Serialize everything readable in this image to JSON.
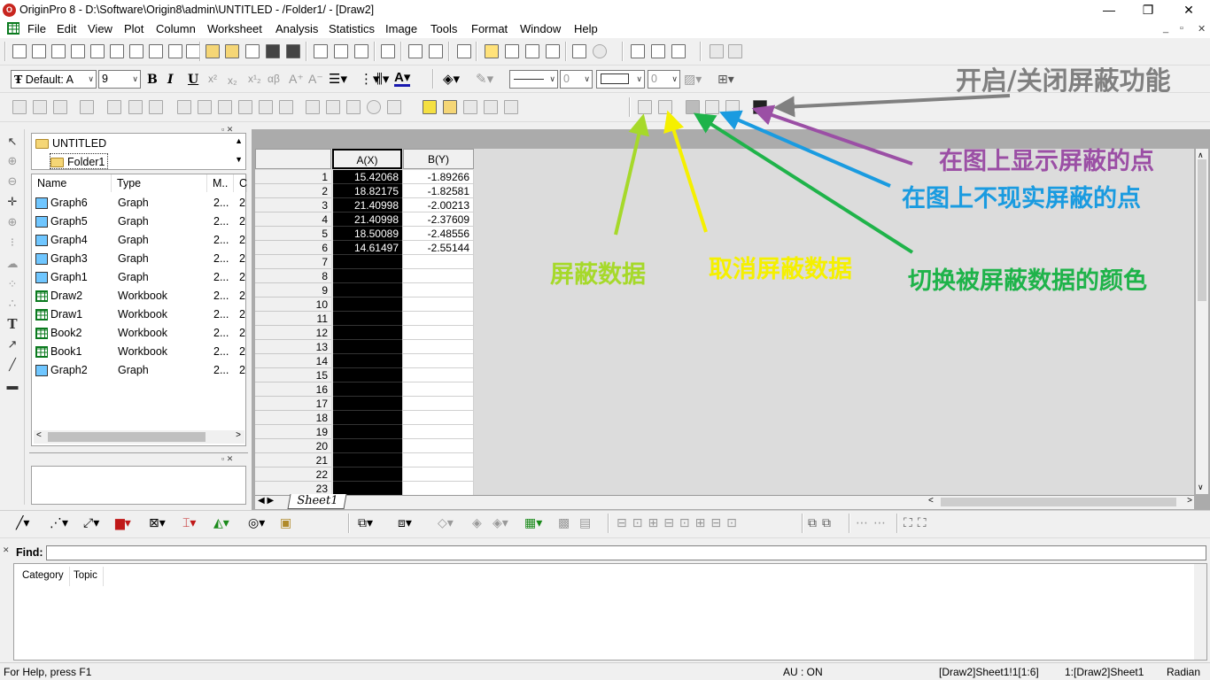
{
  "title_bar": {
    "title": "OriginPro 8 - D:\\Software\\Origin8\\admin\\UNTITLED - /Folder1/ - [Draw2]",
    "minimize": "—",
    "restore": "❐",
    "close": "✕"
  },
  "menu": {
    "items": [
      "File",
      "Edit",
      "View",
      "Plot",
      "Column",
      "Worksheet",
      "Analysis",
      "Statistics",
      "Image",
      "Tools",
      "Format",
      "Window",
      "Help"
    ],
    "mdi_minimize": "_",
    "mdi_restore": "▫",
    "mdi_close": "✕"
  },
  "format_toolbar": {
    "font": "Default: A",
    "size": "9",
    "bold": "B",
    "italic": "I",
    "underline": "U",
    "line_width": "0",
    "pattern_width": "0"
  },
  "project_explorer": {
    "root": "UNTITLED",
    "folder": "Folder1",
    "columns": [
      "Name",
      "Type",
      "M..",
      "C"
    ],
    "items": [
      {
        "name": "Graph6",
        "type": "Graph",
        "m": "2...",
        "c": "2",
        "kind": "graph"
      },
      {
        "name": "Graph5",
        "type": "Graph",
        "m": "2...",
        "c": "2",
        "kind": "graph"
      },
      {
        "name": "Graph4",
        "type": "Graph",
        "m": "2...",
        "c": "2",
        "kind": "graph"
      },
      {
        "name": "Graph3",
        "type": "Graph",
        "m": "2...",
        "c": "2",
        "kind": "graph"
      },
      {
        "name": "Graph1",
        "type": "Graph",
        "m": "2...",
        "c": "2",
        "kind": "graph"
      },
      {
        "name": "Draw2",
        "type": "Workbook",
        "m": "2...",
        "c": "2",
        "kind": "wb"
      },
      {
        "name": "Draw1",
        "type": "Workbook",
        "m": "2...",
        "c": "2",
        "kind": "wb"
      },
      {
        "name": "Book2",
        "type": "Workbook",
        "m": "2...",
        "c": "2",
        "kind": "wb"
      },
      {
        "name": "Book1",
        "type": "Workbook",
        "m": "2...",
        "c": "2",
        "kind": "wb"
      },
      {
        "name": "Graph2",
        "type": "Graph",
        "m": "2...",
        "c": "2",
        "kind": "graph"
      }
    ]
  },
  "worksheet": {
    "col_a": "A(X)",
    "col_b": "B(Y)",
    "rows": [
      "1",
      "2",
      "3",
      "4",
      "5",
      "6",
      "7",
      "8",
      "9",
      "10",
      "11",
      "12",
      "13",
      "14",
      "15",
      "16",
      "17",
      "18",
      "19",
      "20",
      "21",
      "22",
      "23"
    ],
    "a_values": [
      "15.42068",
      "18.82175",
      "21.40998",
      "21.40998",
      "18.50089",
      "14.61497"
    ],
    "b_values": [
      "-1.89266",
      "-1.82581",
      "-2.00213",
      "-2.37609",
      "-2.48556",
      "-2.55144"
    ],
    "sheet_tab": "Sheet1"
  },
  "annotations": {
    "toggle_mask": "开启/关闭屏蔽功能",
    "show_masked": "在图上显示屏蔽的点",
    "hide_masked": "在图上不现实屏蔽的点",
    "mask_data": "屏蔽数据",
    "unmask_data": "取消屏蔽数据",
    "swap_color": "切换被屏蔽数据的颜色",
    "colors": {
      "gray": "#808080",
      "purple": "#9b4fa5",
      "blue": "#1a9be0",
      "yellow": "#f5f000",
      "lime": "#a6d92a",
      "green": "#1fb34a"
    }
  },
  "find": {
    "label": "Find:",
    "tabs": [
      "Category",
      "Topic"
    ]
  },
  "status": {
    "help": "For Help, press F1",
    "au": "AU : ON",
    "cell": "[Draw2]Sheet1!1[1:6]",
    "sheet": "1:[Draw2]Sheet1",
    "angle": "Radian"
  }
}
